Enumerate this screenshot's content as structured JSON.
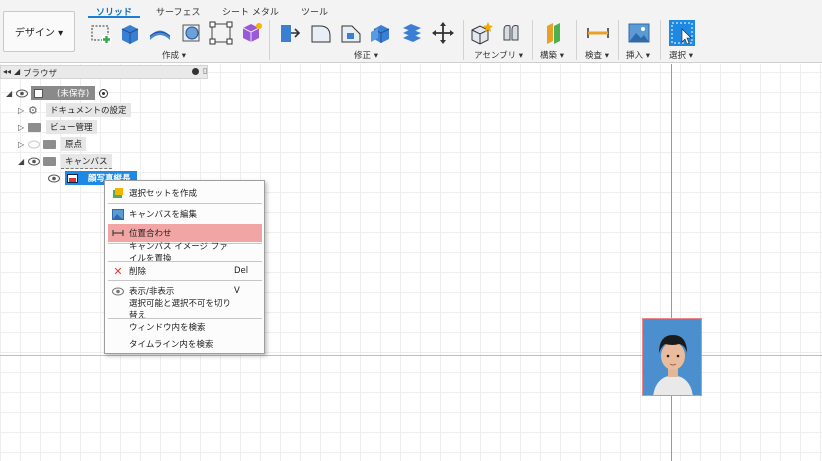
{
  "ribbon": {
    "workspace_label": "デザイン ▾",
    "tabs": [
      "ソリッド",
      "サーフェス",
      "シート メタル",
      "ツール"
    ],
    "groups": {
      "create": "作成 ▾",
      "modify": "修正 ▾",
      "assemble": "アセンブリ ▾",
      "construct": "構築 ▾",
      "inspect": "検査 ▾",
      "insert": "挿入 ▾",
      "select": "選択 ▾"
    }
  },
  "browser": {
    "title": "ブラウザ",
    "items": [
      {
        "label": "(未保存)"
      },
      {
        "label": "ドキュメントの設定"
      },
      {
        "label": "ビュー管理"
      },
      {
        "label": "原点"
      },
      {
        "label": "キャンバス"
      },
      {
        "label": "顔写真縦長"
      }
    ]
  },
  "context_menu": {
    "items": [
      {
        "label": "選択セットを作成",
        "shortcut": ""
      },
      {
        "label": "キャンバスを編集",
        "shortcut": ""
      },
      {
        "label": "位置合わせ",
        "shortcut": ""
      },
      {
        "label": "キャンバス イメージ ファイルを置換",
        "shortcut": ""
      },
      {
        "label": "削除",
        "shortcut": "Del"
      },
      {
        "label": "表示/非表示",
        "shortcut": "V"
      },
      {
        "label": "選択可能と選択不可を切り替え",
        "shortcut": ""
      },
      {
        "label": "ウィンドウ内を検索",
        "shortcut": ""
      },
      {
        "label": "タイムライン内を検索",
        "shortcut": ""
      }
    ]
  },
  "colors": {
    "accent": "#1b7fd1",
    "highlight": "#f2a5a5",
    "selected": "#1e88e5",
    "axis_x": "#f3a8a8",
    "axis_y": "#9090e6"
  }
}
